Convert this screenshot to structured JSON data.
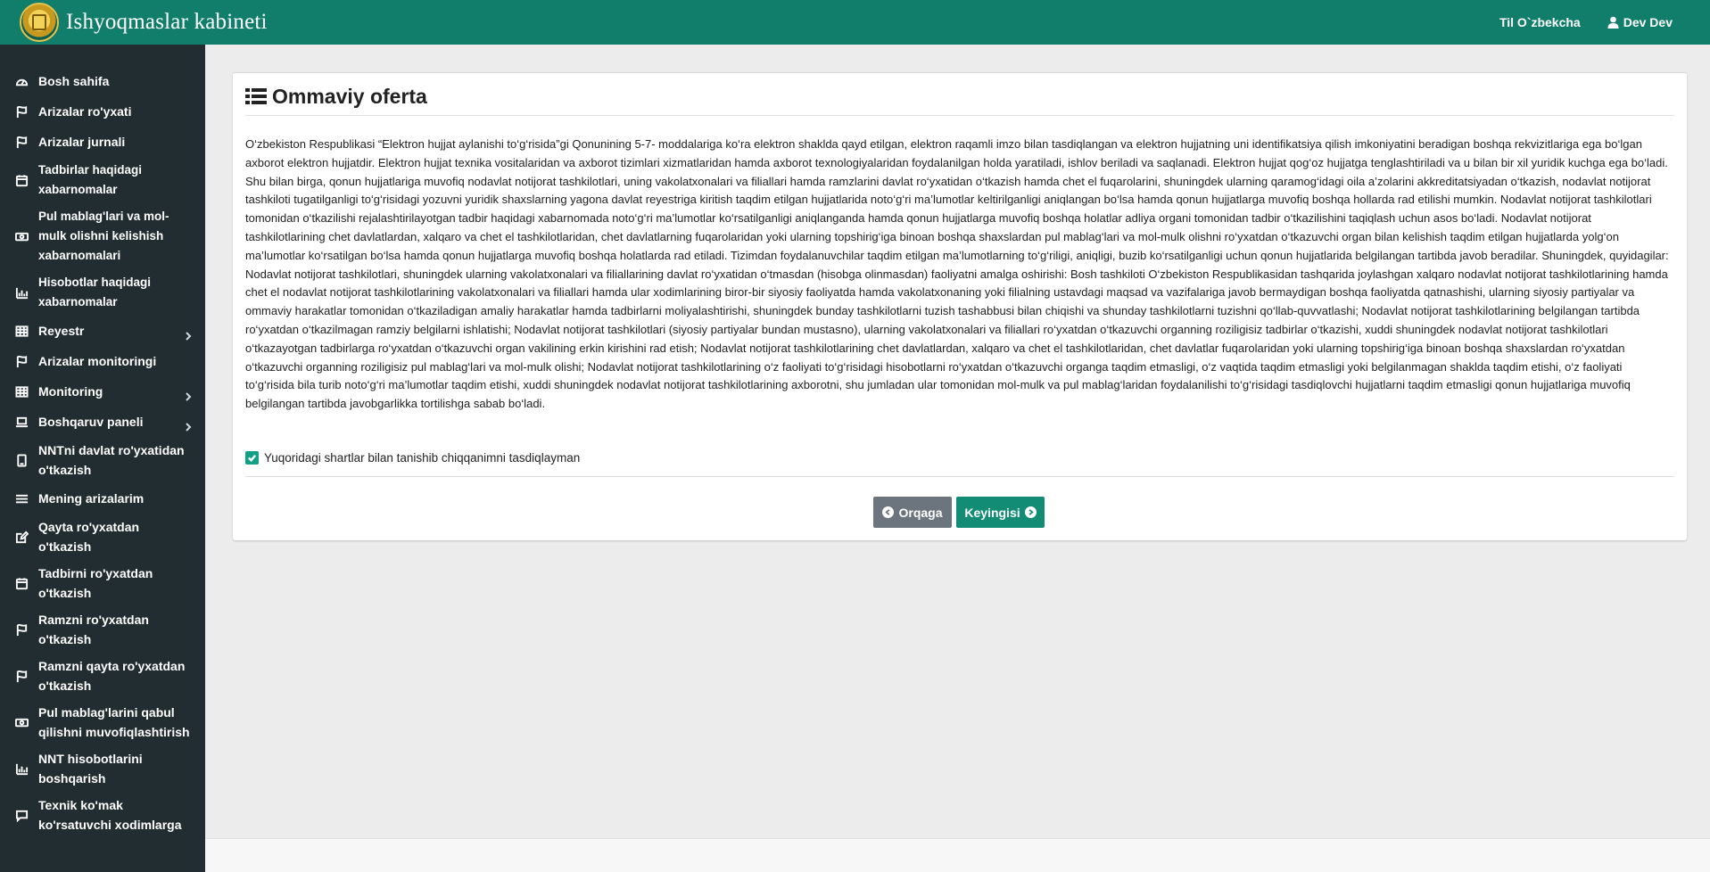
{
  "header": {
    "app_title": "Ishyoqmaslar kabineti",
    "language_label": "Til O`zbekcha",
    "user_name": "Dev Dev",
    "bg_color": "#117e6b"
  },
  "sidebar": {
    "bg_color": "#222d32",
    "items": [
      {
        "label": "Bosh sahifa",
        "icon": "dashboard-icon"
      },
      {
        "label": "Arizalar ro'yxati",
        "icon": "flag-icon"
      },
      {
        "label": "Arizalar jurnali",
        "icon": "flag-icon"
      },
      {
        "label": "Tadbirlar haqidagi xabarnomalar",
        "icon": "calendar-icon"
      },
      {
        "label": "Pul mablag'lari va mol-mulk olishni kelishish xabarnomalari",
        "icon": "money-icon"
      },
      {
        "label": "Hisobotlar haqidagi xabarnomalar",
        "icon": "bar-chart-icon"
      },
      {
        "label": "Reyestr",
        "icon": "table-icon",
        "has_submenu": true
      },
      {
        "label": "Arizalar monitoringi",
        "icon": "flag-icon"
      },
      {
        "label": "Monitoring",
        "icon": "table-icon",
        "has_submenu": true
      },
      {
        "label": "Boshqaruv paneli",
        "icon": "laptop-icon",
        "has_submenu": true
      },
      {
        "label": "NNTni davlat ro'yxatidan o'tkazish",
        "icon": "tablet-icon"
      },
      {
        "label": "Mening arizalarim",
        "icon": "list-icon"
      },
      {
        "label": "Qayta ro'yxatdan o'tkazish",
        "icon": "edit-icon"
      },
      {
        "label": "Tadbirni ro'yxatdan o'tkazish",
        "icon": "calendar-icon"
      },
      {
        "label": "Ramzni ro'yxatdan o'tkazish",
        "icon": "flag-icon"
      },
      {
        "label": "Ramzni qayta ro'yxatdan o'tkazish",
        "icon": "flag-icon"
      },
      {
        "label": "Pul mablag'larini qabul qilishni muvofiqlashtirish",
        "icon": "money-icon"
      },
      {
        "label": "NNT hisobotlarini boshqarish",
        "icon": "bar-chart-icon"
      },
      {
        "label": "Texnik ko'mak ko'rsatuvchi xodimlarga",
        "icon": "comment-icon"
      }
    ]
  },
  "main": {
    "title": "Ommaviy oferta",
    "offer_text": "O‘zbekiston Respublikasi “Elektron hujjat aylanishi to‘g‘risida”gi Qonunining 5-7- moddalariga ko‘ra elektron shaklda qayd etilgan, elektron raqamli imzo bilan tasdiqlangan va elektron hujjatning uni identifikatsiya qilish imkoniyatini beradigan boshqa rekvizitlariga ega bo‘lgan axborot elektron hujjatdir. Elektron hujjat texnika vositalaridan va axborot tizimlari xizmatlaridan hamda axborot texnologiyalaridan foydalanilgan holda yaratiladi, ishlov beriladi va saqlanadi. Elektron hujjat qog‘oz hujjatga tenglashtiriladi va u bilan bir xil yuridik kuchga ega bo‘ladi. Shu bilan birga, qonun hujjatlariga muvofiq nodavlat notijorat tashkilotlari, uning vakolatxonalari va filiallari hamda ramzlarini davlat ro‘yxatidan o‘tkazish hamda chet el fuqarolarini, shuningdek ularning qaramog‘idagi oila a’zolarini akkreditatsiyadan o‘tkazish, nodavlat notijorat tashkiloti tugatilganligi to‘g‘risidagi yozuvni yuridik shaxslarning yagona davlat reyestriga kiritish taqdim etilgan hujjatlarida noto‘g‘ri ma’lumotlar keltirilganligi aniqlangan bo‘lsa hamda qonun hujjatlarga muvofiq boshqa hollarda rad etilishi mumkin. Nodavlat notijorat tashkilotlari tomonidan o‘tkazilishi rejalashtirilayotgan tadbir haqidagi xabarnomada noto‘g‘ri ma’lumotlar ko‘rsatilganligi aniqlanganda hamda qonun hujjatlarga muvofiq boshqa holatlar adliya organi tomonidan tadbir o‘tkazilishini taqiqlash uchun asos bo‘ladi. Nodavlat notijorat tashkilotlarining chet davlatlardan, xalqaro va chet el tashkilotlaridan, chet davlatlarning fuqarolaridan yoki ularning topshirig‘iga binoan boshqa shaxslardan pul mablag‘lari va mol-mulk olishni ro‘yxatdan o‘tkazuvchi organ bilan kelishish taqdim etilgan hujjatlarda yolg‘on ma’lumotlar ko‘rsatilgan bo‘lsa hamda qonun hujjatlarga muvofiq boshqa holatlarda rad etiladi. Tizimdan foydalanuvchilar taqdim etilgan ma’lumotlarning to‘g‘riligi, aniqligi, buzib ko‘rsatilganligi uchun qonun hujjatlarida belgilangan tartibda javob beradilar. Shuningdek, quyidagilar: Nodavlat notijorat tashkilotlari, shuningdek ularning vakolatxonalari va filiallarining davlat ro‘yxatidan o‘tmasdan (hisobga olinmasdan) faoliyatni amalga oshirishi: Bosh tashkiloti O‘zbekiston Respublikasidan tashqarida joylashgan xalqaro nodavlat notijorat tashkilotlarining hamda chet el nodavlat notijorat tashkilotlarining vakolatxonalari va filiallari hamda ular xodimlarining biror-bir siyosiy faoliyatda hamda vakolatxonaning yoki filialning ustavdagi maqsad va vazifalariga javob bermaydigan boshqa faoliyatda qatnashishi, ularning siyosiy partiyalar va ommaviy harakatlar tomonidan o‘tkaziladigan amaliy harakatlar hamda tadbirlarni moliyalashtirishi, shuningdek bunday tashkilotlarni tuzish tashabbusi bilan chiqishi va shunday tashkilotlarni tuzishni qo‘llab-quvvatlashi; Nodavlat notijorat tashkilotlarining belgilangan tartibda ro‘yxatdan o‘tkazilmagan ramziy belgilarni ishlatishi; Nodavlat notijorat tashkilotlari (siyosiy partiyalar bundan mustasno), ularning vakolatxonalari va filiallari ro‘yxatdan o‘tkazuvchi organning roziligisiz tadbirlar o‘tkazishi, xuddi shuningdek nodavlat notijorat tashkilotlari o‘tkazayotgan tadbirlarga ro‘yxatdan o‘tkazuvchi organ vakilining erkin kirishini rad etish; Nodavlat notijorat tashkilotlarining chet davlatlardan, xalqaro va chet el tashkilotlaridan, chet davlatlar fuqarolaridan yoki ularning topshirig‘iga binoan boshqa shaxslardan ro‘yxatdan o‘tkazuvchi organning roziligisiz pul mablag‘lari va mol-mulk olishi; Nodavlat notijorat tashkilotlarining o‘z faoliyati to‘g‘risidagi hisobotlarni ro‘yxatdan o‘tkazuvchi organga taqdim etmasligi, o‘z vaqtida taqdim etmasligi yoki belgilanmagan shaklda taqdim etishi, o‘z faoliyati to‘g‘risida bila turib noto‘g‘ri ma’lumotlar taqdim etishi, xuddi shuningdek nodavlat notijorat tashkilotlarining axborotni, shu jumladan ular tomonidan mol-mulk va pul mablag‘laridan foydalanilishi to‘g‘risidagi tasdiqlovchi hujjatlarni taqdim etmasligi qonun hujjatlariga muvofiq belgilangan tartibda javobgarlikka tortilishga sabab bo‘ladi.",
    "agree_label": "Yuqoridagi shartlar bilan tanishib chiqqanimni tasdiqlayman",
    "agree_checked": true,
    "back_button": "Orqaga",
    "next_button": "Keyingisi",
    "accent_color": "#128c74"
  }
}
